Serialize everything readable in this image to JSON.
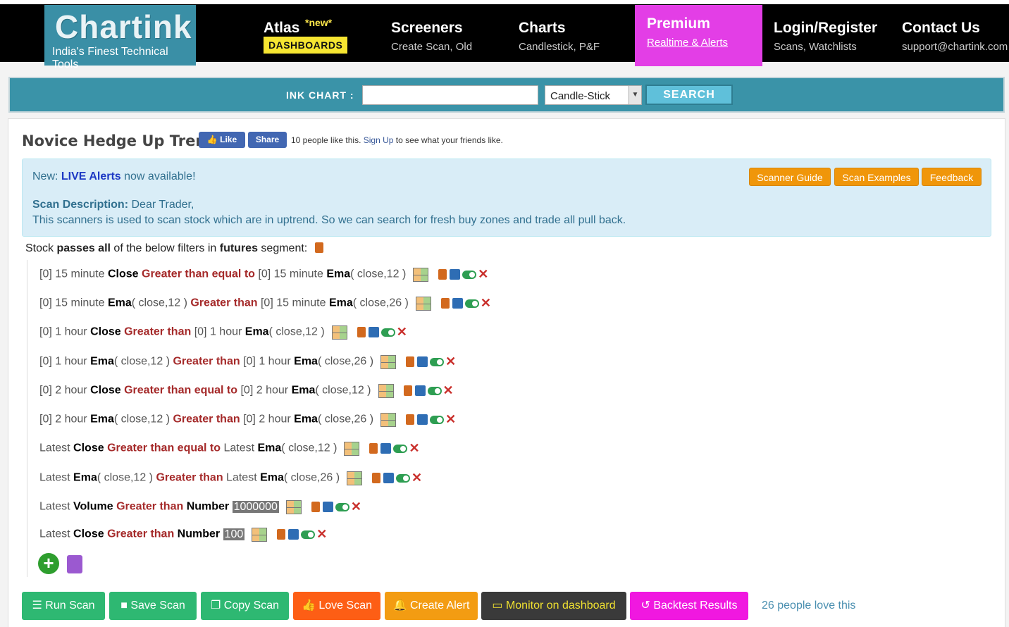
{
  "header": {
    "logo": {
      "title": "Chartink",
      "tagline": "India's Finest Technical Tools"
    },
    "nav": [
      {
        "title": "Atlas",
        "new_tag": "*new*",
        "badge": "DASHBOARDS"
      },
      {
        "title": "Screeners",
        "sub": "Create Scan, Old"
      },
      {
        "title": "Charts",
        "sub": "Candlestick, P&F"
      },
      {
        "title": "Premium",
        "sub": "Realtime & Alerts"
      },
      {
        "title": "Login/Register",
        "sub": "Scans, Watchlists"
      },
      {
        "title": "Contact Us",
        "sub": "support@chartink.com"
      }
    ]
  },
  "search": {
    "label": "INK CHART :",
    "input_value": "",
    "chart_type": "Candle-Stick",
    "button": "SEARCH"
  },
  "scan": {
    "title": "Novice Hedge Up Trend",
    "fb": {
      "like": "Like",
      "share": "Share",
      "text_pre": "10 people like this.",
      "signup": "Sign Up",
      "text_post": "to see what your friends like."
    },
    "alert": {
      "pre": "New:",
      "bold": "LIVE Alerts",
      "post": "now available!"
    },
    "buttons": {
      "guide": "Scanner Guide",
      "examples": "Scan Examples",
      "feedback": "Feedback"
    },
    "description": {
      "label": "Scan Description:",
      "line1": "Dear Trader,",
      "line2": "This scanners is used to scan stock which are in uptrend. So we can search for fresh buy zones and trade all pull back."
    },
    "passes": {
      "p1": "Stock",
      "p2": "passes all",
      "p3": "of the below filters in",
      "p4": "futures",
      "p5": "segment:"
    }
  },
  "filters": [
    {
      "a_off": "[0]",
      "a_tf": "15 minute",
      "a_m": "Close",
      "a_arg": "",
      "op": "Greater than equal to",
      "b_off": "[0]",
      "b_tf": "15 minute",
      "b_m": "Ema",
      "b_arg": "close,12",
      "num": ""
    },
    {
      "a_off": "[0]",
      "a_tf": "15 minute",
      "a_m": "Ema",
      "a_arg": "close,12",
      "op": "Greater than",
      "b_off": "[0]",
      "b_tf": "15 minute",
      "b_m": "Ema",
      "b_arg": "close,26",
      "num": ""
    },
    {
      "a_off": "[0]",
      "a_tf": "1 hour",
      "a_m": "Close",
      "a_arg": "",
      "op": "Greater than",
      "b_off": "[0]",
      "b_tf": "1 hour",
      "b_m": "Ema",
      "b_arg": "close,12",
      "num": ""
    },
    {
      "a_off": "[0]",
      "a_tf": "1 hour",
      "a_m": "Ema",
      "a_arg": "close,12",
      "op": "Greater than",
      "b_off": "[0]",
      "b_tf": "1 hour",
      "b_m": "Ema",
      "b_arg": "close,26",
      "num": ""
    },
    {
      "a_off": "[0]",
      "a_tf": "2 hour",
      "a_m": "Close",
      "a_arg": "",
      "op": "Greater than equal to",
      "b_off": "[0]",
      "b_tf": "2 hour",
      "b_m": "Ema",
      "b_arg": "close,12",
      "num": ""
    },
    {
      "a_off": "[0]",
      "a_tf": "2 hour",
      "a_m": "Ema",
      "a_arg": "close,12",
      "op": "Greater than",
      "b_off": "[0]",
      "b_tf": "2 hour",
      "b_m": "Ema",
      "b_arg": "close,26",
      "num": ""
    },
    {
      "a_off": "",
      "a_tf": "Latest",
      "a_m": "Close",
      "a_arg": "",
      "op": "Greater than equal to",
      "b_off": "",
      "b_tf": "Latest",
      "b_m": "Ema",
      "b_arg": "close,12",
      "num": ""
    },
    {
      "a_off": "",
      "a_tf": "Latest",
      "a_m": "Ema",
      "a_arg": "close,12",
      "op": "Greater than",
      "b_off": "",
      "b_tf": "Latest",
      "b_m": "Ema",
      "b_arg": "close,26",
      "num": ""
    },
    {
      "a_off": "",
      "a_tf": "Latest",
      "a_m": "Volume",
      "a_arg": "",
      "op": "Greater than",
      "b_off": "",
      "b_tf": "",
      "b_m": "Number",
      "b_arg": "",
      "num": "1000000"
    },
    {
      "a_off": "",
      "a_tf": "Latest",
      "a_m": "Close",
      "a_arg": "",
      "op": "Greater than",
      "b_off": "",
      "b_tf": "",
      "b_m": "Number",
      "b_arg": "",
      "num": "100"
    }
  ],
  "actions": {
    "run": "Run Scan",
    "save": "Save Scan",
    "copy": "Copy Scan",
    "love": "Love Scan",
    "alert": "Create Alert",
    "monitor": "Monitor on dashboard",
    "backtest": "Backtest Results",
    "love_count": "26 people love this"
  },
  "colors": {
    "teal": "#3a8fa6",
    "premium": "#e33ee6",
    "orange": "#f0960a",
    "green": "#2eb872",
    "operator": "#a52a2a"
  }
}
